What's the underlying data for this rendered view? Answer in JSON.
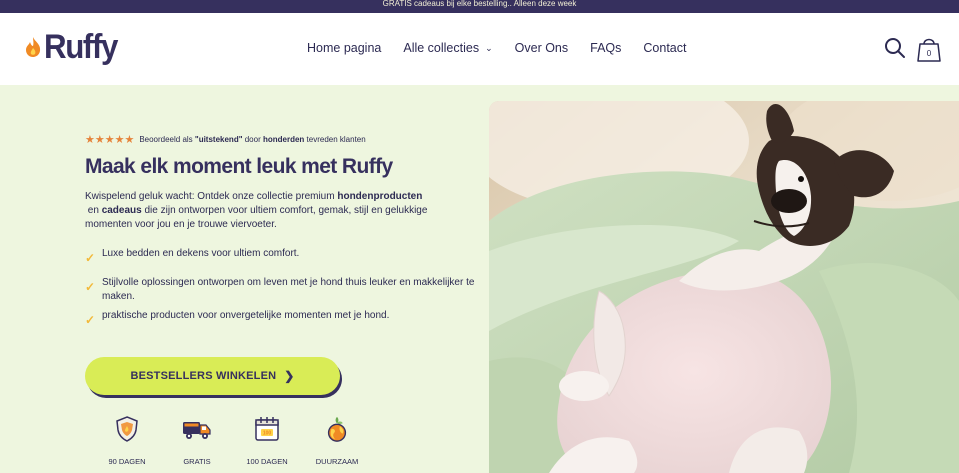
{
  "announcement": "GRATIS cadeaus bij elke bestelling.. Alleen deze week",
  "brand": {
    "name": "Ruffy",
    "color": "#36305e",
    "accent": "#f08a24"
  },
  "nav": {
    "items": [
      "Home pagina",
      "Alle collecties",
      "Over Ons",
      "FAQs",
      "Contact"
    ]
  },
  "header_icons": {
    "search": "search-icon",
    "cart": "shopping-bag-icon",
    "cart_count": "0"
  },
  "hero": {
    "stars": "★★★★★",
    "rating_prefix": "Beoordeeld als ",
    "rating_bold1": "\"uitstekend\"",
    "rating_mid": " door ",
    "rating_bold2": "honderden",
    "rating_suffix": " tevreden klanten",
    "headline": "Maak elk moment leuk met Ruffy",
    "intro_1": "Kwispelend geluk wacht: Ontdek onze collectie premium ",
    "intro_b1": "hondenproducten",
    "intro_2": " en ",
    "intro_b2": "cadeaus",
    "intro_3": " die zijn ontworpen voor ultiem comfort, gemak, stijl en gelukkige momenten voor jou en je trouwe viervoeter.",
    "bullets": [
      "Luxe bedden en dekens voor ultiem comfort.",
      "Stijlvolle oplossingen ontworpen om leven met je hond thuis leuker en makkelijker te maken.",
      "praktische producten voor onvergetelijke momenten met je hond."
    ],
    "cta": "BESTSELLERS WINKELEN",
    "cta_color": "#d9ec56",
    "badges": [
      {
        "icon": "shield-icon",
        "label": "90 DAGEN"
      },
      {
        "icon": "truck-icon",
        "label": "GRATIS"
      },
      {
        "icon": "calendar-icon",
        "label": "100 DAGEN"
      },
      {
        "icon": "globe-icon",
        "label": "DUURZAAM"
      }
    ]
  }
}
